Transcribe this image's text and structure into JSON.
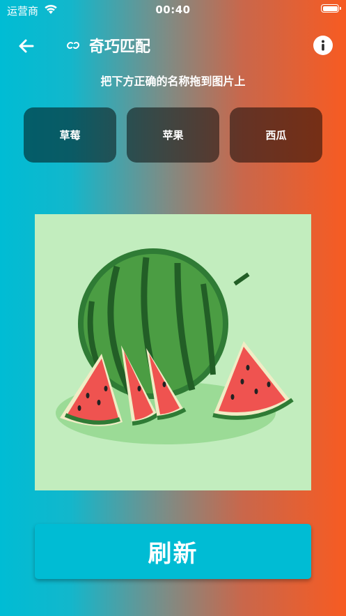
{
  "status_bar": {
    "carrier": "运营商",
    "time": "00:40"
  },
  "nav": {
    "title": "奇巧匹配"
  },
  "instruction": "把下方正确的名称拖到图片上",
  "options": [
    {
      "label": "草莓"
    },
    {
      "label": "苹果"
    },
    {
      "label": "西瓜"
    }
  ],
  "refresh_label": "刷新",
  "colors": {
    "gradient_left": "#00BCD4",
    "gradient_right": "#F75B22",
    "refresh_button": "#00BCD4",
    "photo_background": "#C2EDBE"
  },
  "icons": {
    "back": "arrow-left-icon",
    "link": "link-icon",
    "info": "info-icon",
    "wifi": "wifi-icon",
    "battery": "battery-icon"
  }
}
